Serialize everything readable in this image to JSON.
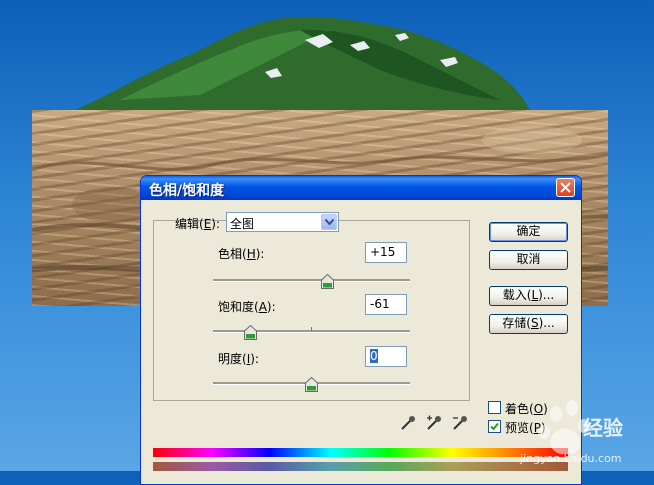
{
  "dialog": {
    "title": "色相/饱和度",
    "edit_label": "编辑(",
    "edit_key": "E",
    "edit_label_end": "):",
    "edit_value": "全图",
    "hue": {
      "label": "色相(",
      "key": "H",
      "label_end": "):",
      "value": "+15",
      "slider_fraction": 0.58
    },
    "saturation": {
      "label": "饱和度(",
      "key": "A",
      "label_end": "):",
      "value": "-61",
      "slider_fraction": 0.19
    },
    "lightness": {
      "label": "明度(",
      "key": "I",
      "label_end": "):",
      "value": "0",
      "slider_fraction": 0.5
    },
    "buttons": {
      "ok": "确定",
      "cancel": "取消",
      "load_a": "载入(",
      "load_key": "L",
      "load_b": ")...",
      "save_a": "存储(",
      "save_key": "S",
      "save_b": ")..."
    },
    "colorize": {
      "label_a": "着色(",
      "key": "O",
      "label_b": ")",
      "checked": false
    },
    "preview": {
      "label_a": "预览(",
      "key": "P",
      "label_b": ")",
      "checked": true
    }
  },
  "watermark": {
    "brand": "经验",
    "url": "jingyan.baidu.com"
  },
  "colors": {
    "title_blue": "#0055e5",
    "dialog_bg": "#ece9d8",
    "slider_green": "#2f9a3b"
  },
  "icons": [
    "close-icon",
    "chevron-down-icon",
    "eyedropper-icon",
    "eyedropper-plus-icon",
    "eyedropper-minus-icon",
    "checkmark-icon"
  ]
}
